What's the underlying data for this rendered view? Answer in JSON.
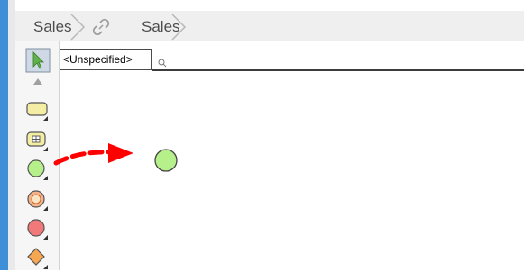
{
  "breadcrumb": {
    "items": [
      {
        "label": "Sales"
      },
      {
        "label": "Sales"
      }
    ]
  },
  "toolbar": {
    "tools": [
      {
        "name": "select-tool",
        "icon": "selection-arrow-icon"
      },
      {
        "name": "scroll-up",
        "icon": "triangle-up-icon"
      },
      {
        "name": "action-tool",
        "icon": "rounded-rect-icon"
      },
      {
        "name": "activity-tool",
        "icon": "activity-icon"
      },
      {
        "name": "initial-node-tool",
        "icon": "green-circle-icon"
      },
      {
        "name": "activity-final-tool",
        "icon": "orange-target-icon"
      },
      {
        "name": "flow-final-tool",
        "icon": "red-circle-icon"
      },
      {
        "name": "decision-tool",
        "icon": "diamond-icon"
      }
    ]
  },
  "canvas": {
    "field": {
      "value": "<Unspecified>"
    },
    "annotation": {
      "icon": "red-dashed-arrow-icon"
    },
    "node": {
      "icon": "initial-node-circle-icon"
    }
  },
  "colors": {
    "accent": "#3f8fd8",
    "node_green": "#b5f08a",
    "arrow_red": "#ff0000"
  }
}
